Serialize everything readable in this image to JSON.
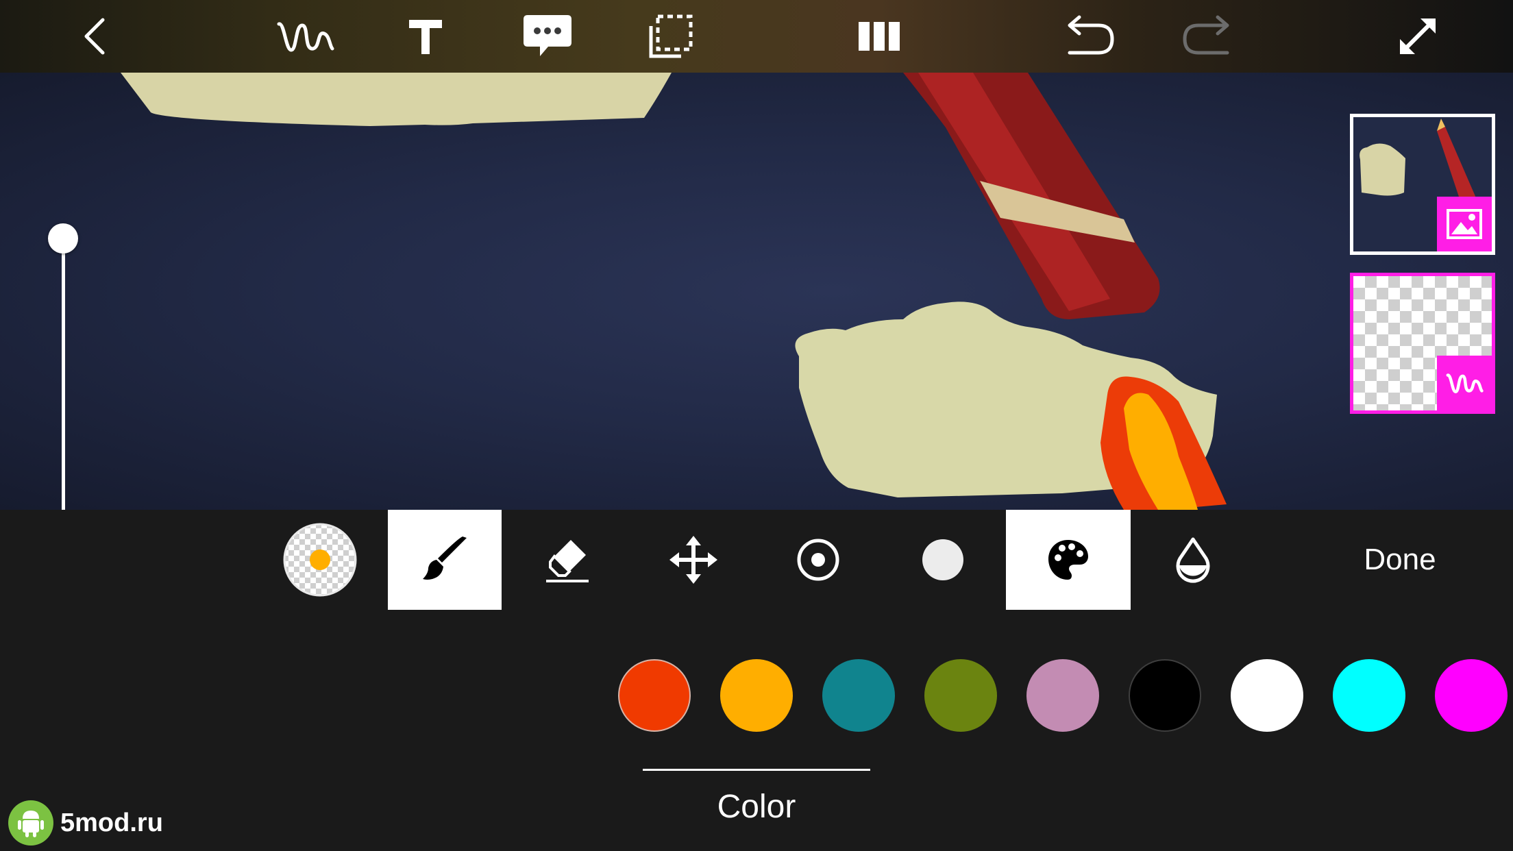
{
  "toolbar": {
    "icons": [
      "back-icon",
      "draw-icon",
      "text-icon",
      "speech-bubble-icon",
      "select-area-icon",
      "frames-icon",
      "undo-icon",
      "redo-icon",
      "fullscreen-icon"
    ]
  },
  "canvas": {
    "brush_size_level": 0.78
  },
  "layers": [
    {
      "type": "image",
      "badge": "image-icon",
      "selected": false
    },
    {
      "type": "drawing",
      "badge": "draw-icon",
      "selected": true
    }
  ],
  "brush_tools": {
    "items": [
      "current-brush-preview",
      "brush-icon",
      "eraser-icon",
      "move-icon",
      "radial-icon",
      "brush-size-icon",
      "palette-icon",
      "opacity-drop-icon"
    ],
    "selected": [
      "brush-icon",
      "palette-icon"
    ],
    "current_color": "#ffae00",
    "done_label": "Done"
  },
  "palette": {
    "colors": [
      "#f03a00",
      "#ffae00",
      "#10848e",
      "#6b8410",
      "#c38cb3",
      "#000000",
      "#ffffff",
      "#00ffff",
      "#ff00ff"
    ],
    "tab_label": "Color"
  },
  "watermark": {
    "text": "5mod.ru"
  }
}
